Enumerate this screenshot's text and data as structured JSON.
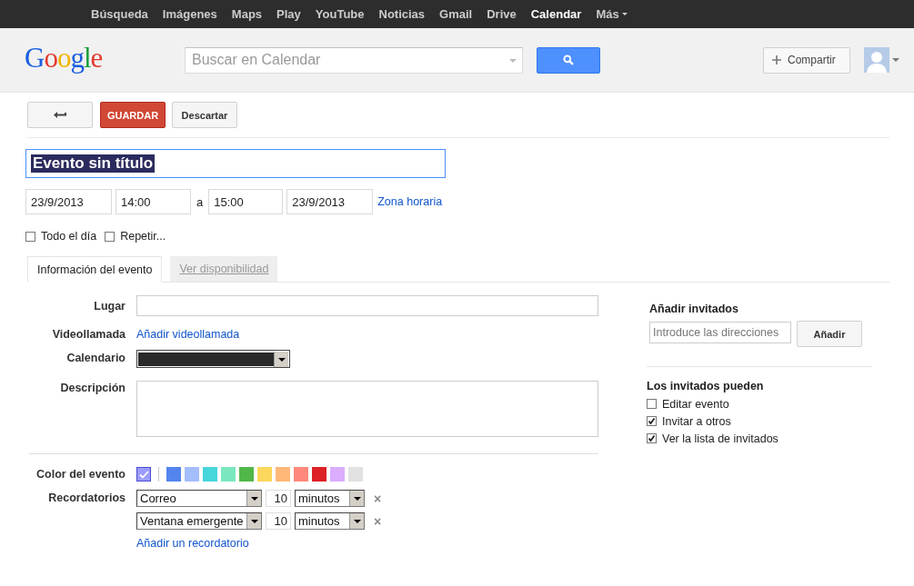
{
  "top_nav": {
    "items": [
      {
        "label": "Búsqueda",
        "selected": false
      },
      {
        "label": "Imágenes",
        "selected": false
      },
      {
        "label": "Maps",
        "selected": false
      },
      {
        "label": "Play",
        "selected": false
      },
      {
        "label": "YouTube",
        "selected": false
      },
      {
        "label": "Noticias",
        "selected": false
      },
      {
        "label": "Gmail",
        "selected": false
      },
      {
        "label": "Drive",
        "selected": false
      },
      {
        "label": "Calendar",
        "selected": true
      }
    ],
    "more": "Más"
  },
  "header": {
    "logo": "Google",
    "search": {
      "placeholder": "Buscar en Calendar"
    },
    "share_button": "Compartir"
  },
  "toolbar": {
    "save_button": "GUARDAR",
    "discard_button": "Descartar"
  },
  "event": {
    "title": "Evento sin título",
    "start_date": "23/9/2013",
    "start_time": "14:00",
    "separator": "a",
    "end_time": "15:00",
    "end_date": "23/9/2013",
    "timezone_link": "Zona horaria"
  },
  "options": [
    {
      "label": "Todo el día",
      "checked": false
    },
    {
      "label": "Repetir...",
      "checked": false
    }
  ],
  "tabs": [
    {
      "label": "Información del evento",
      "selected": true
    },
    {
      "label": "Ver disponibilidad",
      "selected": false
    }
  ],
  "details": {
    "location_label": "Lugar",
    "video_label": "Videollamada",
    "video_link": "Añadir videollamada",
    "calendar_label": "Calendario",
    "description_label": "Descripción",
    "color_label": "Color del evento",
    "colors": [
      {
        "color": "#9a9cff",
        "selected": true
      },
      {
        "color": "#5484ed",
        "selected": false
      },
      {
        "color": "#a4bdfc",
        "selected": false
      },
      {
        "color": "#46d6db",
        "selected": false
      },
      {
        "color": "#7ae7bf",
        "selected": false
      },
      {
        "color": "#51b749",
        "selected": false
      },
      {
        "color": "#fbd75b",
        "selected": false
      },
      {
        "color": "#ffb878",
        "selected": false
      },
      {
        "color": "#ff887c",
        "selected": false
      },
      {
        "color": "#dc2127",
        "selected": false
      },
      {
        "color": "#dbadff",
        "selected": false
      },
      {
        "color": "#e1e1e1",
        "selected": false
      }
    ],
    "reminders_label": "Recordatorios",
    "reminders": [
      {
        "method": "Correo",
        "amount": "10",
        "unit": "minutos",
        "remove": "×"
      },
      {
        "method": "Ventana emergente",
        "amount": "10",
        "unit": "minutos",
        "remove": "×"
      }
    ],
    "add_reminder": "Añadir un recordatorio"
  },
  "guests": {
    "title": "Añadir invitados",
    "input_placeholder": "Introduce las direcciones",
    "add_button": "Añadir",
    "permissions_title": "Los invitados pueden",
    "permissions": [
      {
        "label": "Editar evento",
        "checked": false
      },
      {
        "label": "Invitar a otros",
        "checked": true
      },
      {
        "label": "Ver la lista de invitados",
        "checked": true
      }
    ]
  }
}
